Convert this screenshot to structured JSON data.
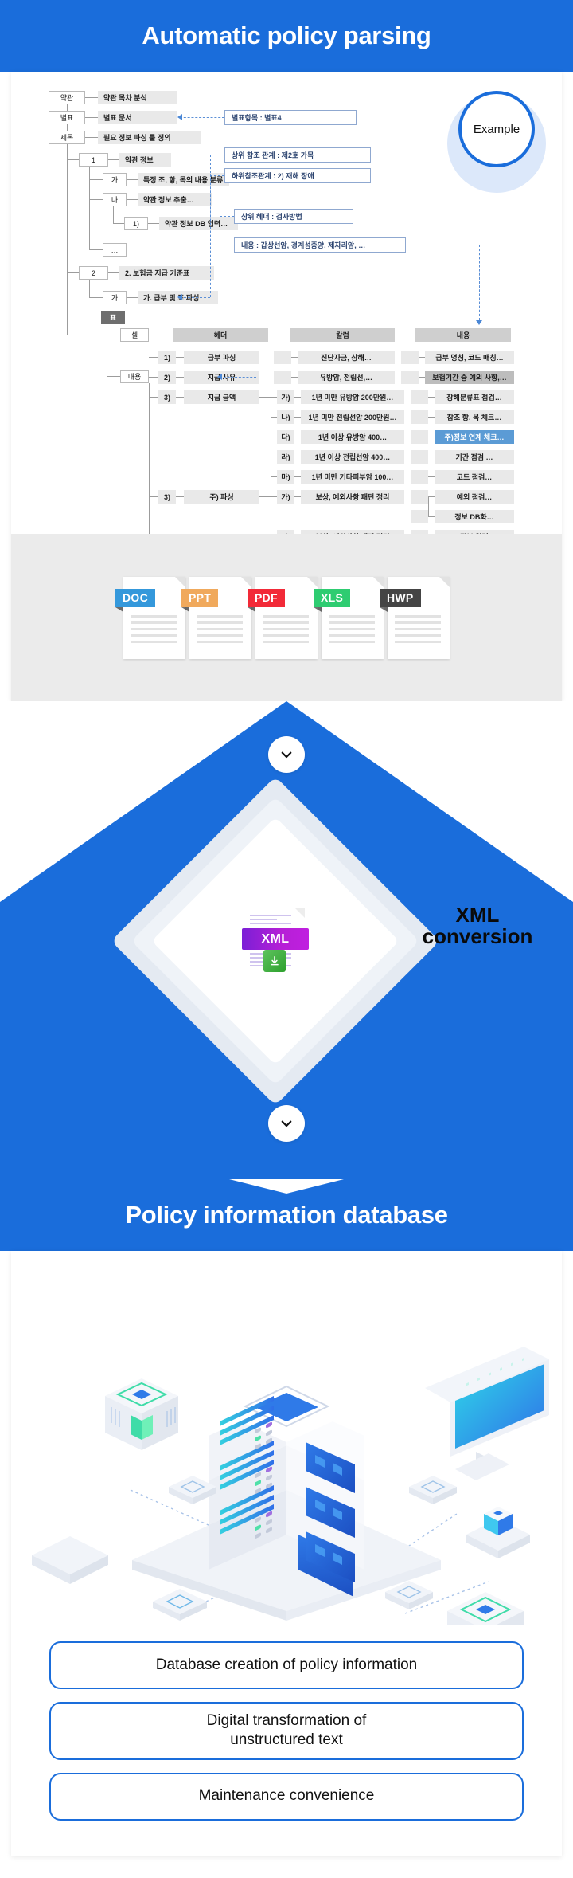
{
  "section1": {
    "title": "Automatic policy parsing",
    "badge": "Example",
    "tree": {
      "rows": [
        {
          "key": "약관",
          "label": "약관 목차 분석"
        },
        {
          "key": "별표",
          "label": "별표 문서"
        },
        {
          "key": "제목",
          "label": "필요 정보 파싱 룰 정의"
        },
        {
          "key": "1",
          "label": "약관 정보"
        },
        {
          "key": "가",
          "label": "특정 조, 항, 목의 내용 분류…"
        },
        {
          "key": "나",
          "label": "약관 정보 추출…"
        },
        {
          "key": "1)",
          "label": "약관 정보 DB 입력…"
        },
        {
          "key": "…",
          "label": ""
        },
        {
          "key": "2",
          "label": "2. 보험금 지급 기준표"
        },
        {
          "key": "가",
          "label": "가. 급부 및 표 파싱"
        }
      ],
      "table_node": "표",
      "side_labels": {
        "cell": "셀",
        "content": "내용"
      },
      "columns": [
        "헤더",
        "칼럼",
        "내용"
      ],
      "table_rows": [
        {
          "num": "1)",
          "header": "급부 파싱",
          "subnum": "",
          "column": "진단자금, 상해…",
          "content": "급부 명칭, 코드 매칭…",
          "style": "normal"
        },
        {
          "num": "2)",
          "header": "지급 사유",
          "subnum": "",
          "column": "유방암, 전립선,…",
          "content": "보험기간 중 예외 사항,…",
          "style": "dark"
        },
        {
          "num": "3)",
          "header": "지급 금액",
          "subnum": "가)",
          "column": "1년 미만 유방암 200만원…",
          "content": "장해분류표 점검…",
          "style": "normal"
        },
        {
          "num": "",
          "header": "",
          "subnum": "나)",
          "column": "1년 미만 전립선암 200만원…",
          "content": "참조 항, 목 체크…",
          "style": "normal"
        },
        {
          "num": "",
          "header": "",
          "subnum": "다)",
          "column": "1년 이상 유방암 400…",
          "content": "주)정보 연계 체크…",
          "style": "blue"
        },
        {
          "num": "",
          "header": "",
          "subnum": "라)",
          "column": "1년 이상 전립선암 400…",
          "content": "기간 점검 …",
          "style": "normal"
        },
        {
          "num": "",
          "header": "",
          "subnum": "마)",
          "column": "1년 미만 기타피부암 100…",
          "content": "코드 점검…",
          "style": "normal"
        },
        {
          "num": "3)",
          "header": "주) 파싱",
          "subnum": "가)",
          "column": "보상, 예외사항 패턴 정리",
          "content": "예외 점검…",
          "style": "normal"
        },
        {
          "num": "",
          "header": "",
          "subnum": "",
          "column": "",
          "content": "정보 DB화…",
          "style": "normal"
        },
        {
          "num": "",
          "header": "",
          "subnum": "나)",
          "column": "보상, 예외사항 패턴 정리",
          "content": "정보 입력",
          "style": "normal"
        }
      ],
      "callouts": [
        "별표항목 : 별표4",
        "상위 참조 관계 : 제2호 가목",
        "하위참조관계 : 2) 재해 장애",
        "상위 헤더 : 검사방법",
        "내용 : 갑상선암, 경계성종양, 제자리암, …"
      ]
    },
    "file_types": [
      {
        "label": "DOC",
        "color": "#3498db",
        "fold": "#1c6ca8"
      },
      {
        "label": "PPT",
        "color": "#f0a95c",
        "fold": "#b87a33"
      },
      {
        "label": "PDF",
        "color": "#f22a38",
        "fold": "#a8101c"
      },
      {
        "label": "XLS",
        "color": "#2ecc71",
        "fold": "#169b4c"
      },
      {
        "label": "HWP",
        "color": "#444444",
        "fold": "#1c1c1c"
      }
    ]
  },
  "section2": {
    "label_line1": "XML",
    "label_line2": "conversion",
    "xml_icon_text": "XML",
    "chevron_top": "chevron-down-icon",
    "chevron_bottom": "chevron-down-icon",
    "accent": "#1a6ddb"
  },
  "section3": {
    "title": "Policy information database",
    "buttons": [
      "Database creation of policy information",
      "Digital transformation of\nunstructured text",
      "Maintenance convenience"
    ]
  }
}
